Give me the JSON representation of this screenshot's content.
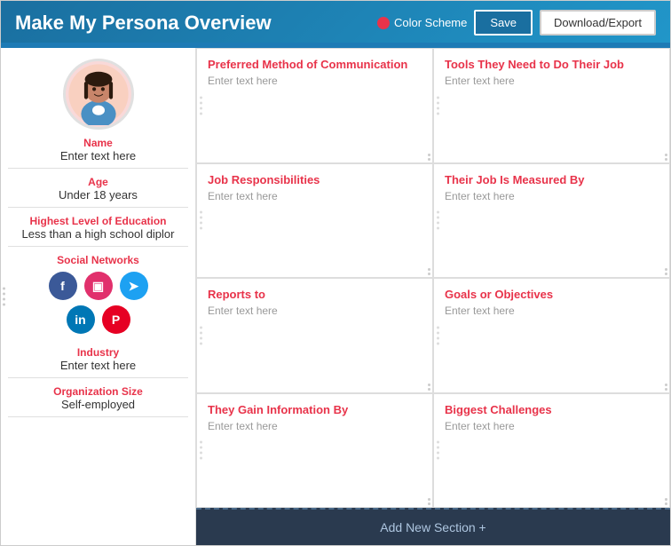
{
  "header": {
    "title": "Make My Persona Overview",
    "color_scheme_label": "Color Scheme",
    "save_label": "Save",
    "download_label": "Download/Export"
  },
  "left_panel": {
    "name_label": "Name",
    "name_value": "Enter text here",
    "age_label": "Age",
    "age_value": "Under 18 years",
    "education_label": "Highest Level of Education",
    "education_value": "Less than a high school diplor",
    "social_label": "Social Networks",
    "industry_label": "Industry",
    "industry_value": "Enter text here",
    "org_size_label": "Organization Size",
    "org_size_value": "Self-employed"
  },
  "cards": [
    {
      "title": "Preferred Method of Communication",
      "content": "Enter text here"
    },
    {
      "title": "Tools They Need to Do Their Job",
      "content": "Enter text here"
    },
    {
      "title": "Job Responsibilities",
      "content": "Enter text here"
    },
    {
      "title": "Their Job Is Measured By",
      "content": "Enter text here"
    },
    {
      "title": "Reports to",
      "content": "Enter text here"
    },
    {
      "title": "Goals or Objectives",
      "content": "Enter text here"
    },
    {
      "title": "They Gain Information By",
      "content": "Enter text here"
    },
    {
      "title": "Biggest Challenges",
      "content": "Enter text here"
    }
  ],
  "footer": {
    "add_section_label": "Add New Section +"
  }
}
